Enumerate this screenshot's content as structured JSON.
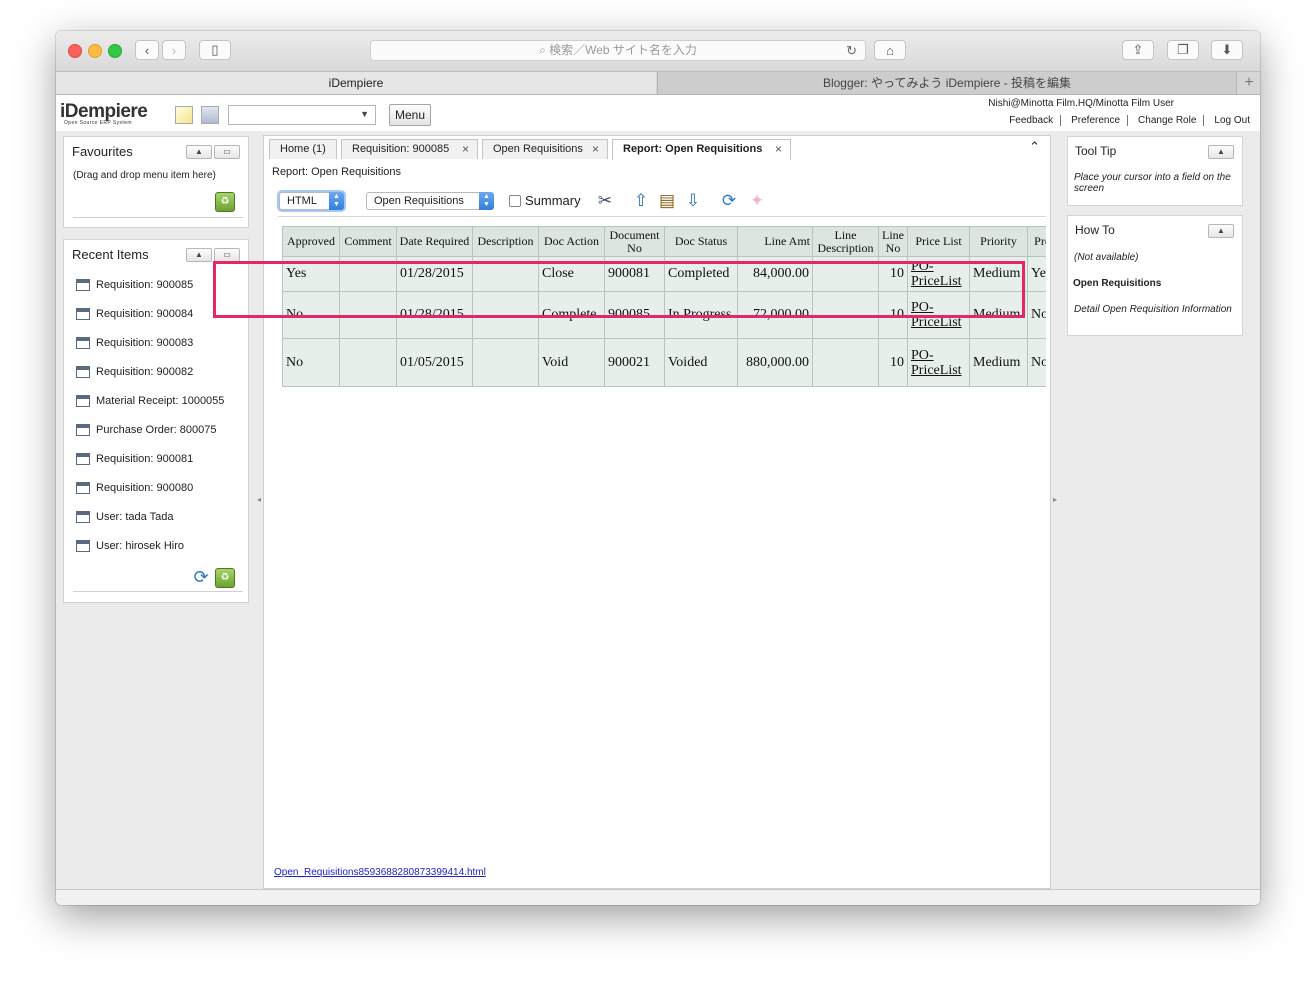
{
  "browser": {
    "address_placeholder": "検索／Web サイト名を入力",
    "tabs": [
      "iDempiere",
      "Blogger: やってみよう iDempiere - 投稿を編集"
    ],
    "new_tab": "+"
  },
  "app": {
    "logo": "iDempiere",
    "logo_sub": "Open Source ERP System",
    "menu_button": "Menu",
    "user": "Nishi@Minotta Film.HQ/Minotta Film User",
    "links": [
      "Feedback",
      "Preference",
      "Change Role",
      "Log Out"
    ]
  },
  "favourites": {
    "title": "Favourites",
    "hint": "(Drag and drop menu item here)"
  },
  "recent": {
    "title": "Recent Items",
    "items": [
      "Requisition: 900085",
      "Requisition: 900084",
      "Requisition: 900083",
      "Requisition: 900082",
      "Material Receipt: 1000055",
      "Purchase Order: 800075",
      "Requisition: 900081",
      "Requisition: 900080",
      "User: tada Tada",
      "User: hirosek Hiro"
    ]
  },
  "window_tabs": [
    "Home (1)",
    "Requisition: 900085",
    "Open Requisitions",
    "Report: Open Requisitions"
  ],
  "report": {
    "title": "Report: Open Requisitions",
    "format": "HTML",
    "report_name": "Open Requisitions",
    "summary_label": "Summary",
    "file_link": "Open_Requisitions8593688280873399414.html"
  },
  "table": {
    "headers": [
      "Approved",
      "Comment",
      "Date Required",
      "Description",
      "Doc Action",
      "Document No",
      "Doc Status",
      "Line Amt",
      "Line Description",
      "Line No",
      "Price List",
      "Priority",
      "Pro"
    ],
    "rows": [
      [
        "Yes",
        "",
        "01/28/2015",
        "",
        "Close",
        "900081",
        "Completed",
        "84,000.00",
        "",
        "10",
        "PO-PriceList",
        "Medium",
        "Ye"
      ],
      [
        "No",
        "",
        "01/28/2015",
        "",
        "Complete",
        "900085",
        "In Progress",
        "72,000.00",
        "",
        "10",
        "PO-PriceList",
        "Medium",
        "No"
      ],
      [
        "No",
        "",
        "01/05/2015",
        "",
        "Void",
        "900021",
        "Voided",
        "880,000.00",
        "",
        "10",
        "PO-PriceList",
        "Medium",
        "No"
      ]
    ]
  },
  "tooltip": {
    "title": "Tool Tip",
    "text": "Place your cursor into a field on the screen"
  },
  "howto": {
    "title": "How To",
    "not_available": "(Not available)",
    "heading": "Open Requisitions",
    "desc": "Detail Open Requisition Information"
  },
  "colors": {
    "highlight": "#e5266a",
    "table_cell": "#e6efea",
    "table_header": "#dde5e0"
  }
}
